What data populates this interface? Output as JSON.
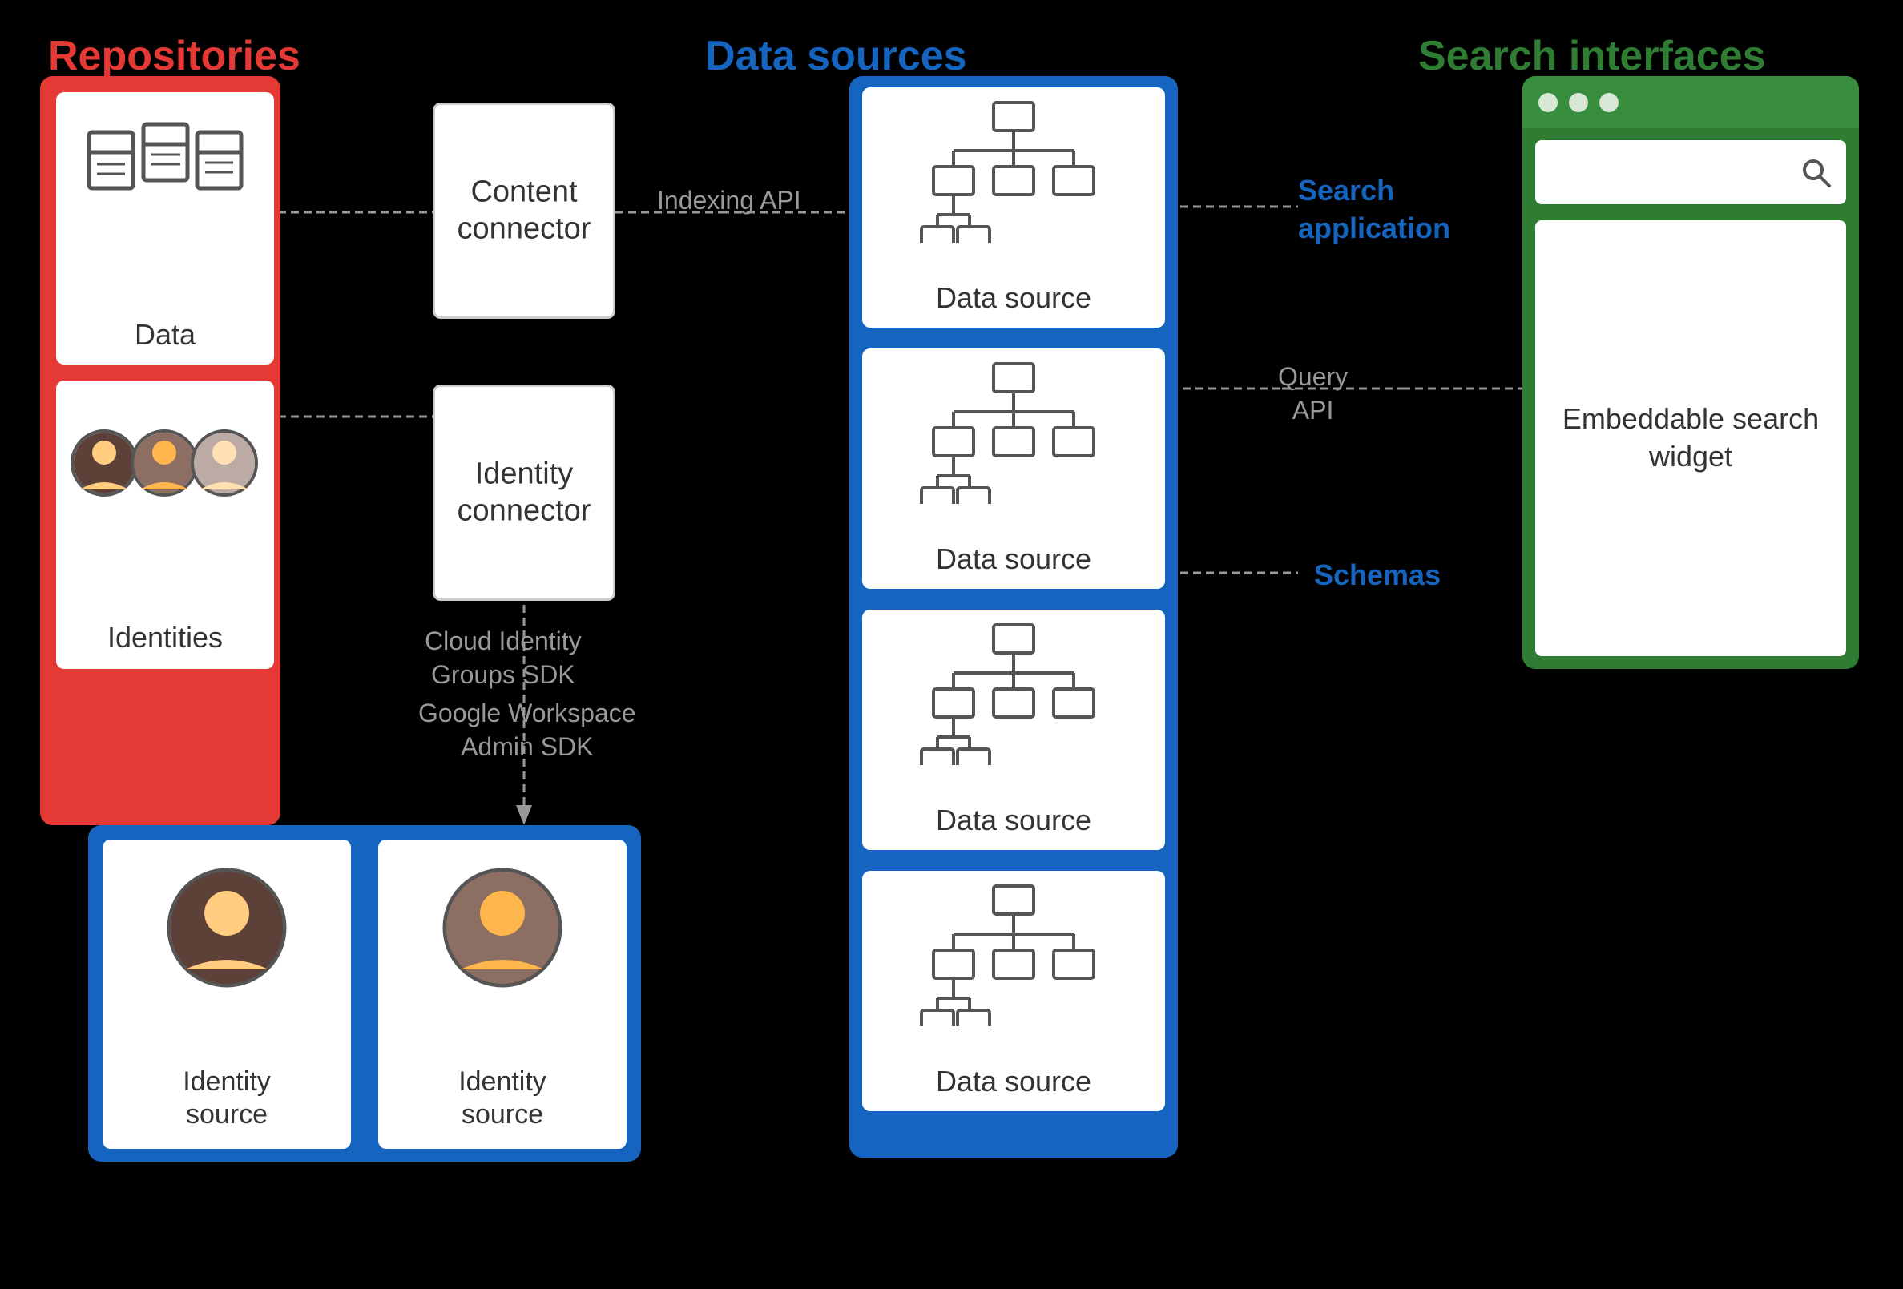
{
  "sections": {
    "repositories_label": "Repositories",
    "repositories_color": "#E53935",
    "data_sources_label": "Data sources",
    "data_sources_color": "#1565C0",
    "search_interfaces_label": "Search interfaces",
    "search_interfaces_color": "#2E7D32"
  },
  "repositories": {
    "data_label": "Data",
    "identities_label": "Identities"
  },
  "connectors": {
    "content_label": "Content\nconnector",
    "identity_label": "Identity\nconnector"
  },
  "data_sources": {
    "items": [
      "Data source",
      "Data source",
      "Data source",
      "Data source"
    ]
  },
  "identity_sources": {
    "items": [
      "Identity\nsource",
      "Identity\nsource"
    ]
  },
  "api_labels": {
    "indexing": "Indexing API",
    "cloud_identity": "Cloud Identity\nGroups SDK",
    "google_workspace": "Google Workspace\nAdmin SDK",
    "query": "Query\nAPI"
  },
  "callouts": {
    "search_application": "Search\napplication",
    "schemas": "Schemas"
  },
  "search_interface": {
    "embeddable_label": "Embeddable\nsearch\nwidget",
    "search_placeholder": "Search"
  }
}
